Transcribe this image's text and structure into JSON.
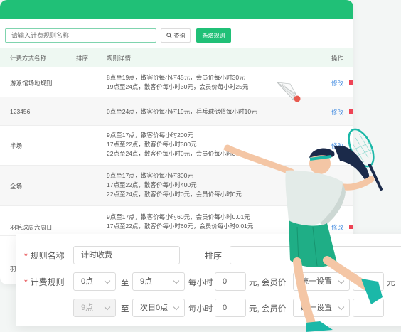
{
  "toolbar": {
    "search_placeholder": "请输入计费规则名称",
    "query_label": "查询",
    "add_label": "新增规则"
  },
  "table": {
    "headers": {
      "name": "计费方式名称",
      "order": "排序",
      "detail": "规则详情",
      "ops": "操作"
    },
    "rows": [
      {
        "name": "游泳馆场地规则",
        "lines": [
          "8点至19点，散客价每小时45元，会员价每小时30元",
          "19点至24点，散客价每小时30元，会员价每小时25元"
        ],
        "edit": "修改"
      },
      {
        "name": "123456",
        "lines": [
          "0点至24点，散客价每小时19元，乒乓球储值每小时10元"
        ],
        "edit": "修改"
      },
      {
        "name": "半场",
        "lines": [
          "9点至17点，散客价每小时200元",
          "17点至22点，散客价每小时300元",
          "22点至24点，散客价每小时0元，会员价每小时0元"
        ],
        "edit": "修改"
      },
      {
        "name": "全场",
        "lines": [
          "9点至17点，散客价每小时300元",
          "17点至22点，散客价每小时400元",
          "22点至24点，散客价每小时0元，会员价每小时0元"
        ],
        "edit": "修改"
      },
      {
        "name": "羽毛球周六周日",
        "lines": [
          "9点至17点，散客价每小时60元，会员价每小时0.01元",
          "17点至22点，散客价每小时60元，会员价每小时0.01元"
        ],
        "edit": "修改"
      }
    ],
    "partial_row_name": "羽"
  },
  "form": {
    "rule_name_label": "规则名称",
    "rule_name_value": "计时收费",
    "order_label": "排序",
    "billing_label": "计费规则",
    "row1": {
      "from": "0点",
      "to_word": "至",
      "to": "9点",
      "per_hour": "每小时",
      "price": "0",
      "member_text": "元, 会员价",
      "member_select": "统一设置",
      "unit": "元"
    },
    "row2": {
      "from": "9点",
      "to_word": "至",
      "to": "次日0点",
      "per_hour": "每小时",
      "price": "0",
      "member_text": "元, 会员价",
      "member_select": "统一设置",
      "unit": "元"
    }
  },
  "colors": {
    "brand": "#20c077",
    "link": "#4a90e2",
    "required": "#e4393c"
  }
}
